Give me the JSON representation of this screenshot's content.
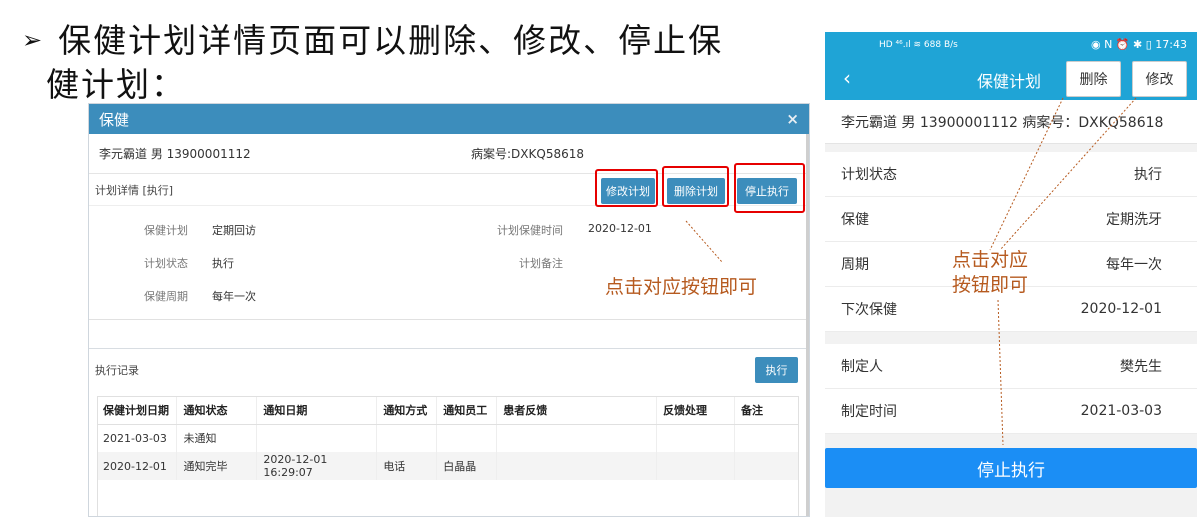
{
  "heading": {
    "bullet": "➢",
    "line1": "保健计划详情页面可以删除、修改、停止保",
    "line2": "健计划："
  },
  "desktop": {
    "title": "保健",
    "close": "×",
    "patient": "李元霸道 男 13900001112",
    "case_no": "病案号:DXKQ58618",
    "plan_title": "计划详情 [执行]",
    "buttons": {
      "edit": "修改计划",
      "delete": "删除计划",
      "stop": "停止执行"
    },
    "fields": {
      "plan_label": "保健计划",
      "plan_value": "定期回访",
      "status_label": "计划状态",
      "status_value": "执行",
      "cycle_label": "保健周期",
      "cycle_value": "每年一次",
      "time_label": "计划保健时间",
      "time_value": "2020-12-01",
      "remark_label": "计划备注"
    },
    "annotation": "点击对应按钮即可",
    "records": {
      "title": "执行记录",
      "button": "执行",
      "headers": [
        "保健计划日期",
        "通知状态",
        "通知日期",
        "通知方式",
        "通知员工",
        "患者反馈",
        "反馈处理",
        "备注"
      ],
      "rows": [
        [
          "2021-03-03",
          "未通知",
          "",
          "",
          "",
          "",
          "",
          ""
        ],
        [
          "2020-12-01",
          "通知完毕",
          "2020-12-01 16:29:07",
          "电话",
          "白晶晶",
          "",
          "",
          ""
        ]
      ]
    }
  },
  "phone": {
    "status_left": "HD ⁴⁶.ıl ≋ 688 B/s",
    "status_right": "◉ N ⏰ ✱ ▯ 17:43",
    "back": "‹",
    "title": "保健计划",
    "delete": "删除",
    "edit": "修改",
    "patient": "李元霸道  男 13900001112   病案号：DXKQ58618",
    "rows": [
      {
        "label": "计划状态",
        "value": "执行"
      },
      {
        "label": "保健",
        "value": "定期洗牙"
      },
      {
        "label": "周期",
        "value": "每年一次"
      },
      {
        "label": "下次保健",
        "value": "2020-12-01"
      }
    ],
    "rows2": [
      {
        "label": "制定人",
        "value": "樊先生"
      },
      {
        "label": "制定时间",
        "value": "2021-03-03"
      }
    ],
    "annotation_line1": "点击对应",
    "annotation_line2": "按钮即可",
    "stop": "停止执行"
  }
}
